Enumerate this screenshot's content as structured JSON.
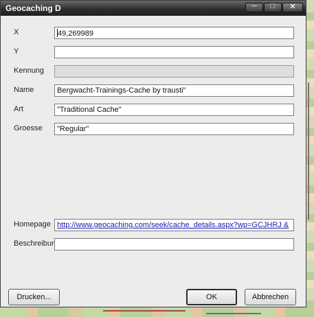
{
  "window": {
    "title": "Geocaching D"
  },
  "fields": [
    {
      "label": "X",
      "value": "49,269989",
      "state": "focused"
    },
    {
      "label": "Y",
      "value": "",
      "state": "normal"
    },
    {
      "label": "Kennung",
      "value": "",
      "state": "disabled"
    },
    {
      "label": "Name",
      "value": "Bergwacht-Trainings-Cache by trausti\"",
      "state": "normal"
    },
    {
      "label": "Art",
      "value": "\"Traditional Cache\"",
      "state": "normal"
    },
    {
      "label": "Groesse",
      "value": "\"Regular\"",
      "state": "normal"
    }
  ],
  "homepage": {
    "label": "Homepage",
    "value": "http://www.geocaching.com/seek/cache_details.aspx?wp=GCJHRJ &"
  },
  "beschreibung": {
    "label": "Beschreibun",
    "value": ""
  },
  "buttons": {
    "print": "Drucken...",
    "ok": "OK",
    "cancel": "Abbrechen"
  },
  "colors": {
    "titlebar": "#2f2f2f",
    "link": "#1a1ab0",
    "dialog_bg": "#ececec"
  }
}
